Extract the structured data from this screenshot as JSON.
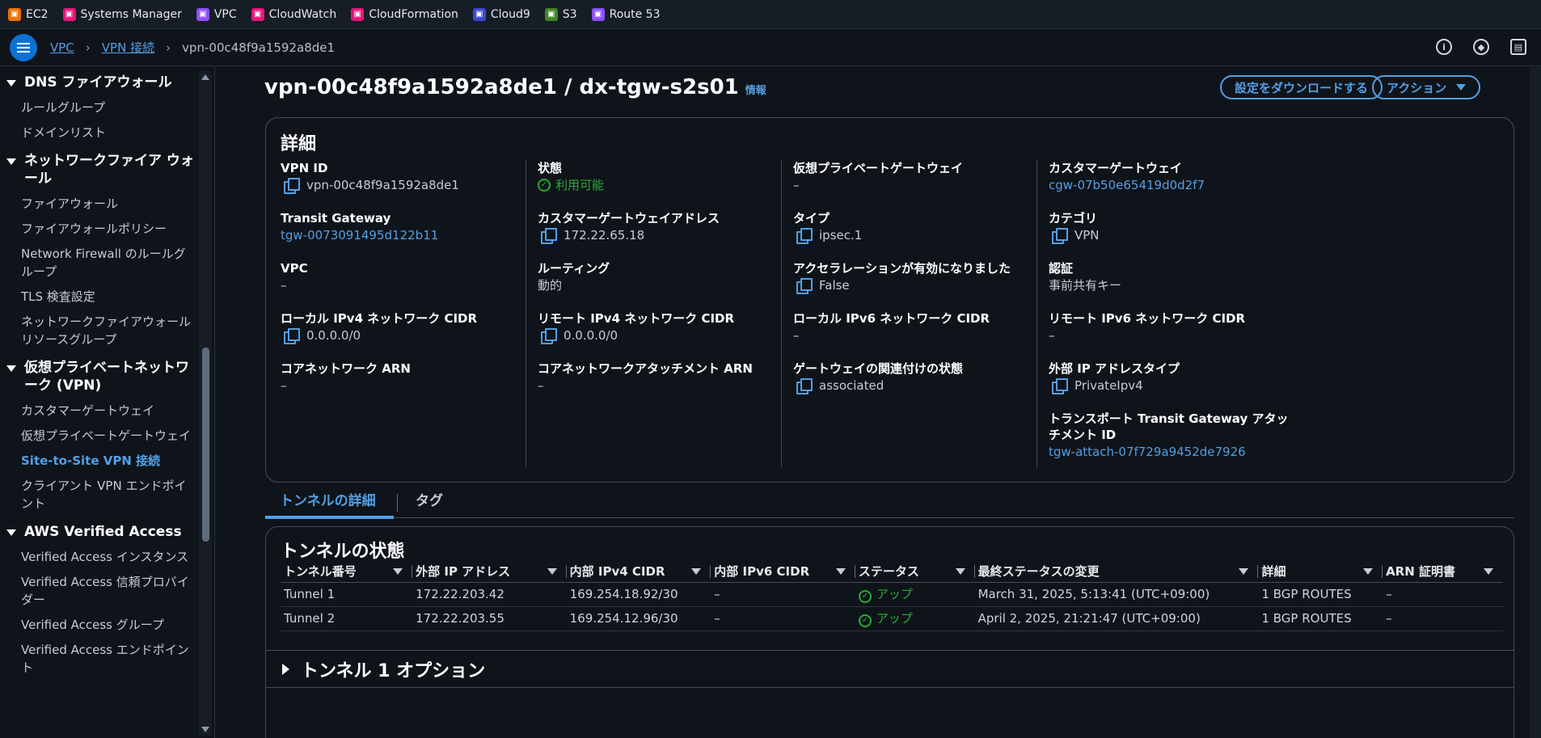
{
  "favorites": [
    {
      "label": "EC2",
      "icon": "ec2-icon",
      "color": "#ed7100"
    },
    {
      "label": "Systems Manager",
      "icon": "systems-manager-icon",
      "color": "#e7157b"
    },
    {
      "label": "VPC",
      "icon": "vpc-icon",
      "color": "#8c4fff"
    },
    {
      "label": "CloudWatch",
      "icon": "cloudwatch-icon",
      "color": "#e7157b"
    },
    {
      "label": "CloudFormation",
      "icon": "cloudformation-icon",
      "color": "#e7157b"
    },
    {
      "label": "Cloud9",
      "icon": "cloud9-icon",
      "color": "#3b48cc"
    },
    {
      "label": "S3",
      "icon": "s3-icon",
      "color": "#3f8624"
    },
    {
      "label": "Route 53",
      "icon": "route53-icon",
      "color": "#8c4fff"
    }
  ],
  "breadcrumb": {
    "vpc": "VPC",
    "vpn": "VPN 接続",
    "current": "vpn-00c48f9a1592a8de1"
  },
  "sidebar": {
    "dns_firewall": "DNS ファイアウォール",
    "rule_groups": "ルールグループ",
    "domain_lists": "ドメインリスト",
    "network_firewall": "ネットワークファイア ウォール",
    "firewalls": "ファイアウォール",
    "firewall_policies": "ファイアウォールポリシー",
    "nf_rule_groups": "Network Firewall のルールグループ",
    "tls": "TLS 検査設定",
    "nf_resource_groups": "ネットワークファイアウォールリソースグループ",
    "vpn_section": "仮想プライベートネットワーク (VPN)",
    "customer_gateways": "カスタマーゲートウェイ",
    "vpgw": "仮想プライベートゲートウェイ",
    "s2s": "Site-to-Site VPN 接続",
    "client_vpn": "クライアント VPN エンドポイント",
    "ava": "AWS Verified Access",
    "va_instances": "Verified Access インスタンス",
    "va_trust": "Verified Access 信頼プロバイダー",
    "va_groups": "Verified Access グループ",
    "va_endpoints": "Verified Access エンドポイント"
  },
  "page": {
    "title": "vpn-00c48f9a1592a8de1 / dx-tgw-s2s01",
    "info": "情報",
    "download_btn": "設定をダウンロードする",
    "actions_btn": "アクション"
  },
  "details": {
    "title": "詳細",
    "vpn_id": {
      "label": "VPN ID",
      "value": "vpn-00c48f9a1592a8de1"
    },
    "tgw": {
      "label": "Transit Gateway",
      "value": "tgw-0073091495d122b11"
    },
    "vpc": {
      "label": "VPC",
      "value": "–"
    },
    "local_v4": {
      "label": "ローカル IPv4 ネットワーク CIDR",
      "value": "0.0.0.0/0"
    },
    "core_arn": {
      "label": "コアネットワーク ARN",
      "value": "–"
    },
    "state": {
      "label": "状態",
      "value": "利用可能"
    },
    "cgw_addr": {
      "label": "カスタマーゲートウェイアドレス",
      "value": "172.22.65.18"
    },
    "routing": {
      "label": "ルーティング",
      "value": "動的"
    },
    "remote_v4": {
      "label": "リモート IPv4 ネットワーク CIDR",
      "value": "0.0.0.0/0"
    },
    "core_attach_arn": {
      "label": "コアネットワークアタッチメント ARN",
      "value": "–"
    },
    "vpgw": {
      "label": "仮想プライベートゲートウェイ",
      "value": "–"
    },
    "type": {
      "label": "タイプ",
      "value": "ipsec.1"
    },
    "accel": {
      "label": "アクセラレーションが有効になりました",
      "value": "False"
    },
    "local_v6": {
      "label": "ローカル IPv6 ネットワーク CIDR",
      "value": "–"
    },
    "gw_assoc": {
      "label": "ゲートウェイの関連付けの状態",
      "value": "associated"
    },
    "cgw": {
      "label": "カスタマーゲートウェイ",
      "value": "cgw-07b50e65419d0d2f7"
    },
    "category": {
      "label": "カテゴリ",
      "value": "VPN"
    },
    "auth": {
      "label": "認証",
      "value": "事前共有キー"
    },
    "remote_v6": {
      "label": "リモート IPv6 ネットワーク CIDR",
      "value": "–"
    },
    "ext_ip_type": {
      "label": "外部 IP アドレスタイプ",
      "value": "PrivateIpv4"
    },
    "transport_att": {
      "label": "トランスポート Transit Gateway アタッチメント ID",
      "value": "tgw-attach-07f729a9452de7926"
    }
  },
  "tabs": {
    "tunnel": "トンネルの詳細",
    "tags": "タグ"
  },
  "tunnels": {
    "title": "トンネルの状態",
    "headers": [
      "トンネル番号",
      "外部 IP アドレス",
      "内部 IPv4 CIDR",
      "内部 IPv6 CIDR",
      "ステータス",
      "最終ステータスの変更",
      "詳細",
      "ARN 証明書"
    ],
    "rows": [
      [
        "Tunnel 1",
        "172.22.203.42",
        "169.254.18.92/30",
        "–",
        "アップ",
        "March 31, 2025, 5:13:41 (UTC+09:00)",
        "1 BGP ROUTES",
        "–"
      ],
      [
        "Tunnel 2",
        "172.22.203.55",
        "169.254.12.96/30",
        "–",
        "アップ",
        "April 2, 2025, 21:21:47 (UTC+09:00)",
        "1 BGP ROUTES",
        "–"
      ]
    ],
    "option1": "トンネル 1 オプション"
  }
}
